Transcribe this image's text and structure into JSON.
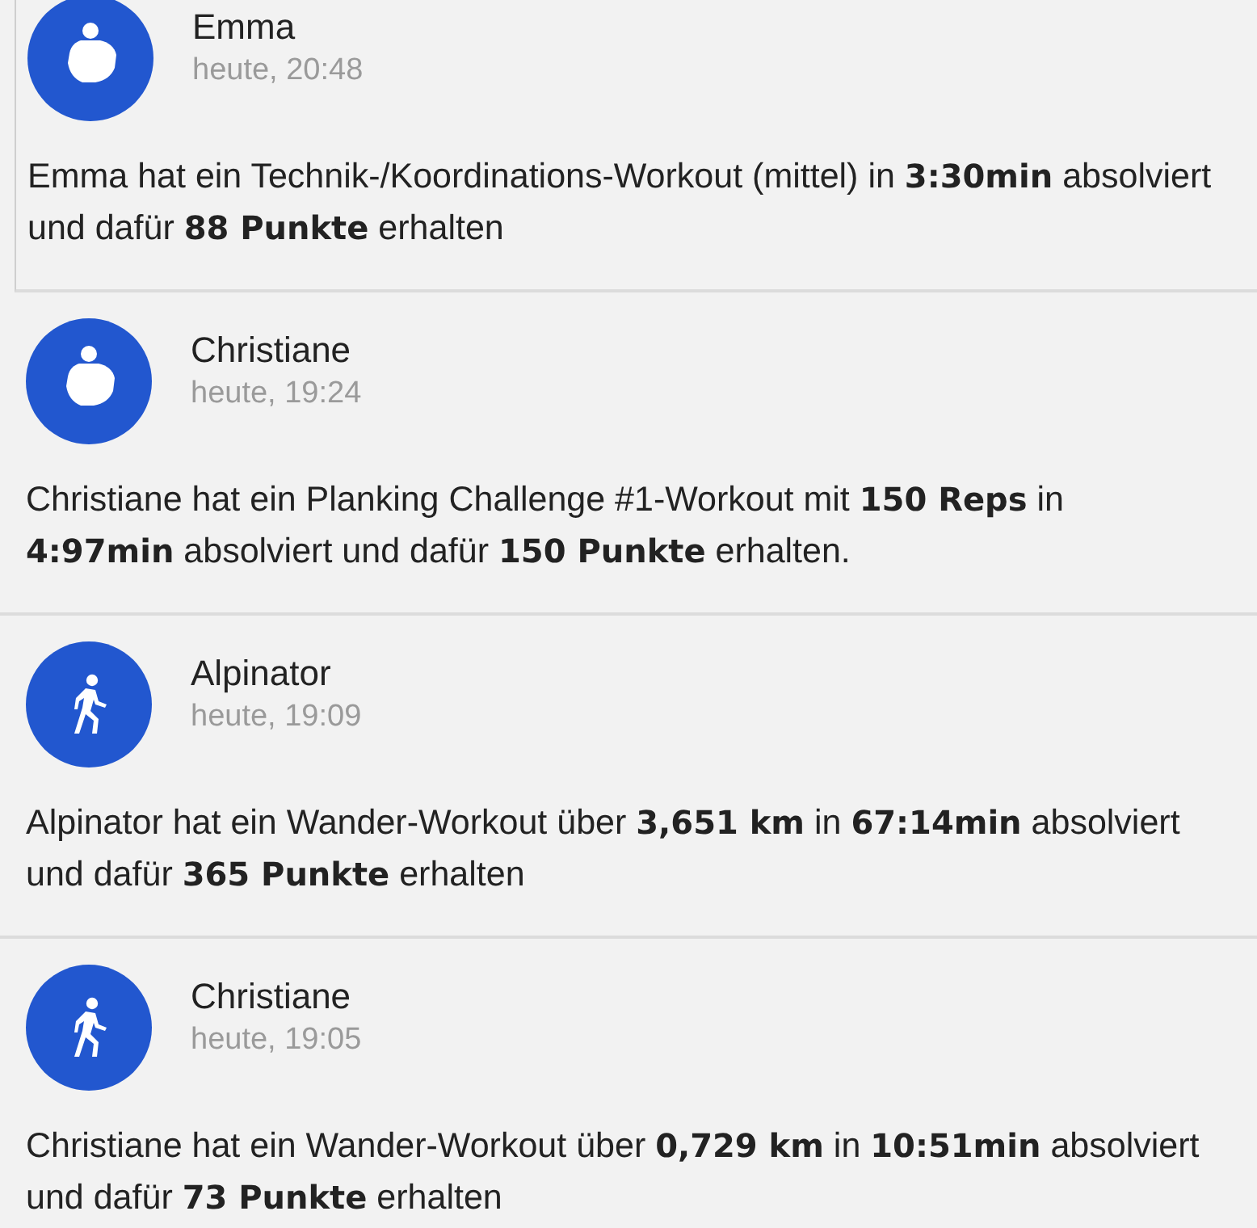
{
  "feed": [
    {
      "kind": "strength",
      "name": "Emma",
      "time": "heute, 20:48",
      "text": "Emma  hat ein Technik-/Koordinations-Workout (mittel) in **3:30min** absolviert und dafür **88 Punkte** erhalten"
    },
    {
      "kind": "strength",
      "name": "Christiane",
      "time": "heute, 19:24",
      "text": "Christiane hat ein Planking Challenge #1-Workout mit **150 Reps** in **4:97min** absolviert und dafür **150 Punkte** erhalten."
    },
    {
      "kind": "walk",
      "name": "Alpinator",
      "time": "heute, 19:09",
      "text": "Alpinator hat ein Wander-Workout über **3,651 km** in **67:14min** absolviert und dafür **365 Punkte** erhalten"
    },
    {
      "kind": "walk",
      "name": "Christiane",
      "time": "heute, 19:05",
      "text": "Christiane hat ein Wander-Workout über **0,729 km** in **10:51min** absolviert und dafür **73 Punkte** erhalten"
    }
  ]
}
